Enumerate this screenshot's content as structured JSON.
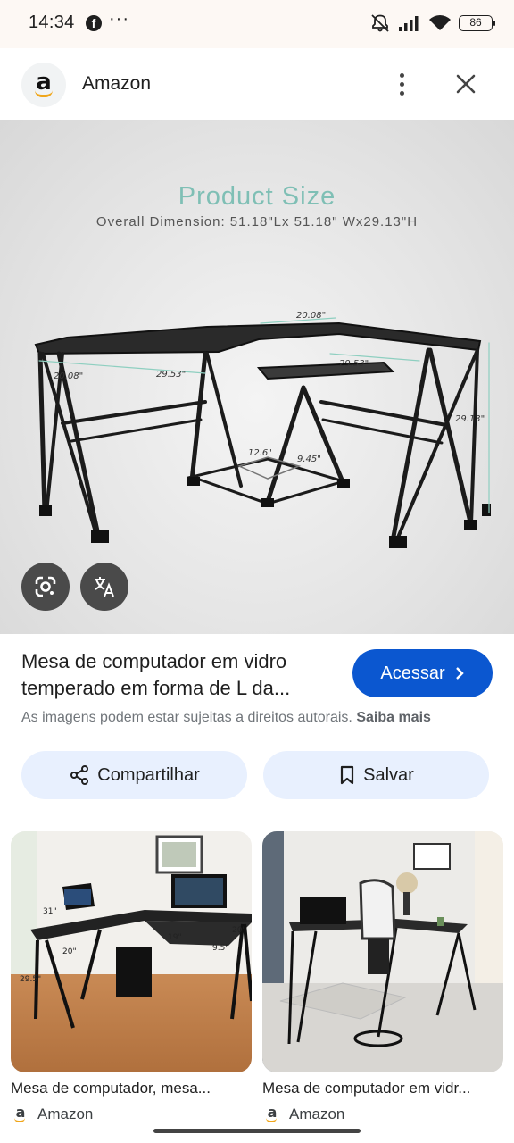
{
  "status_bar": {
    "time": "14:34",
    "fb_glyph": "f",
    "more": "···",
    "battery": "86",
    "icons": [
      "facebook-icon",
      "more-icon",
      "mute-icon",
      "signal-icon",
      "wifi-icon",
      "battery-icon"
    ]
  },
  "header": {
    "site_logo": "a",
    "site_name": "Amazon",
    "icons": [
      "more-vert-icon",
      "close-icon"
    ]
  },
  "hero": {
    "title": "Product Size",
    "subtitle": "Overall Dimension: 51.18\"Lx 51.18\" Wx29.13\"H",
    "dims": {
      "top_depth": "20.08\"",
      "left_depth": "20.08\"",
      "left_length": "29.53\"",
      "right_length": "29.53\"",
      "height": "29.13\"",
      "tower_w": "12.6\"",
      "tower_d": "9.45\""
    },
    "icons": [
      "google-lens-icon",
      "translate-icon"
    ]
  },
  "result": {
    "title": "Mesa de computador em vidro temperado em forma de L da...",
    "visit_label": "Acessar",
    "rights_text": "As imagens podem estar sujeitas a direitos autorais.",
    "learn_more": "Saiba mais"
  },
  "actions": {
    "share_label": "Compartilhar",
    "save_label": "Salvar"
  },
  "related": [
    {
      "title": "Mesa de computador, mesa...",
      "source": "Amazon",
      "logo": "a",
      "labels": [
        "31\"",
        "31\"",
        "20\"",
        "19\"",
        "29.5\"",
        "9.5\"",
        "20\""
      ]
    },
    {
      "title": "Mesa de computador em vidr...",
      "source": "Amazon",
      "logo": "a"
    }
  ],
  "colors": {
    "accent": "#0b57d0",
    "pill": "#e8f0fe",
    "hero_title": "#7fbfb5",
    "amazon_smile": "#f0a61b"
  }
}
